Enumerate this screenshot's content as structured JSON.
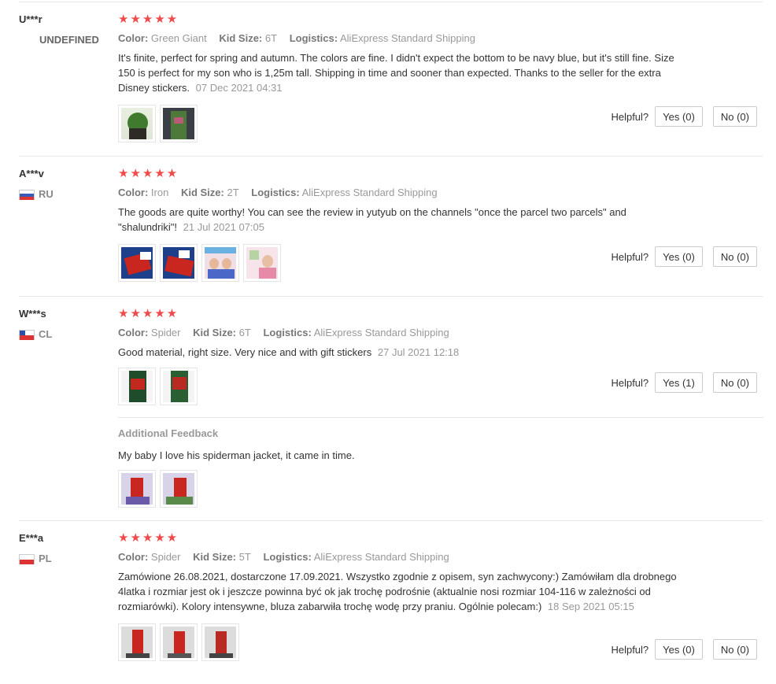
{
  "reviews": [
    {
      "user": "U***r",
      "country": "UNDEFINED",
      "stars": "★★★★★",
      "attrs": [
        {
          "label": "Color:",
          "value": "Green Giant"
        },
        {
          "label": "Kid Size:",
          "value": "6T"
        },
        {
          "label": "Logistics:",
          "value": "AliExpress Standard Shipping"
        }
      ],
      "text": "It's finite, perfect for spring and autumn. The colors are fine. I didn't expect the bottom to be navy blue, but it's still fine. Size 150 is perfect for my son who is 1,25m tall. Shipping in time and sooner than expected. Thanks to the seller for the extra Disney stickers.",
      "date": "07 Dec 2021 04:31",
      "helpful_label": "Helpful?",
      "yes": "Yes (0)",
      "no": "No (0)"
    },
    {
      "user": "A***v",
      "country": "RU",
      "stars": "★★★★★",
      "attrs": [
        {
          "label": "Color:",
          "value": "Iron"
        },
        {
          "label": "Kid Size:",
          "value": "2T"
        },
        {
          "label": "Logistics:",
          "value": "AliExpress Standard Shipping"
        }
      ],
      "text": "The goods are quite worthy! You can see the review in yutyub on the channels \"once the parcel two parcels\" and \"shalundriki\"!",
      "date": "21 Jul 2021 07:05",
      "helpful_label": "Helpful?",
      "yes": "Yes (0)",
      "no": "No (0)"
    },
    {
      "user": "W***s",
      "country": "CL",
      "stars": "★★★★★",
      "attrs": [
        {
          "label": "Color:",
          "value": "Spider"
        },
        {
          "label": "Kid Size:",
          "value": "6T"
        },
        {
          "label": "Logistics:",
          "value": "AliExpress Standard Shipping"
        }
      ],
      "text": "Good material, right size. Very nice and with gift stickers",
      "date": "27 Jul 2021 12:18",
      "helpful_label": "Helpful?",
      "yes": "Yes (1)",
      "no": "No (0)",
      "additional_title": "Additional Feedback",
      "additional_text": "My baby I love his spiderman jacket, it came in time."
    },
    {
      "user": "E***a",
      "country": "PL",
      "stars": "★★★★★",
      "attrs": [
        {
          "label": "Color:",
          "value": "Spider"
        },
        {
          "label": "Kid Size:",
          "value": "5T"
        },
        {
          "label": "Logistics:",
          "value": "AliExpress Standard Shipping"
        }
      ],
      "text": "Zamówione 26.08.2021, dostarczone 17.09.2021. Wszystko zgodnie z opisem, syn zachwycony:) Zamówiłam dla drobnego 4latka i rozmiar jest ok i jeszcze powinna być ok jak trochę podrośnie (aktualnie nosi rozmiar 104-116 w zależności od rozmiarówki). Kolory intensywne, bluza zabarwiła trochę wodę przy praniu. Ogólnie polecam:)",
      "date": "18 Sep 2021 05:15",
      "helpful_label": "Helpful?",
      "yes": "Yes (0)",
      "no": "No (0)"
    }
  ],
  "colors": {
    "star": "#f04a4a",
    "divider": "#e8e8e8",
    "muted": "#999999"
  }
}
